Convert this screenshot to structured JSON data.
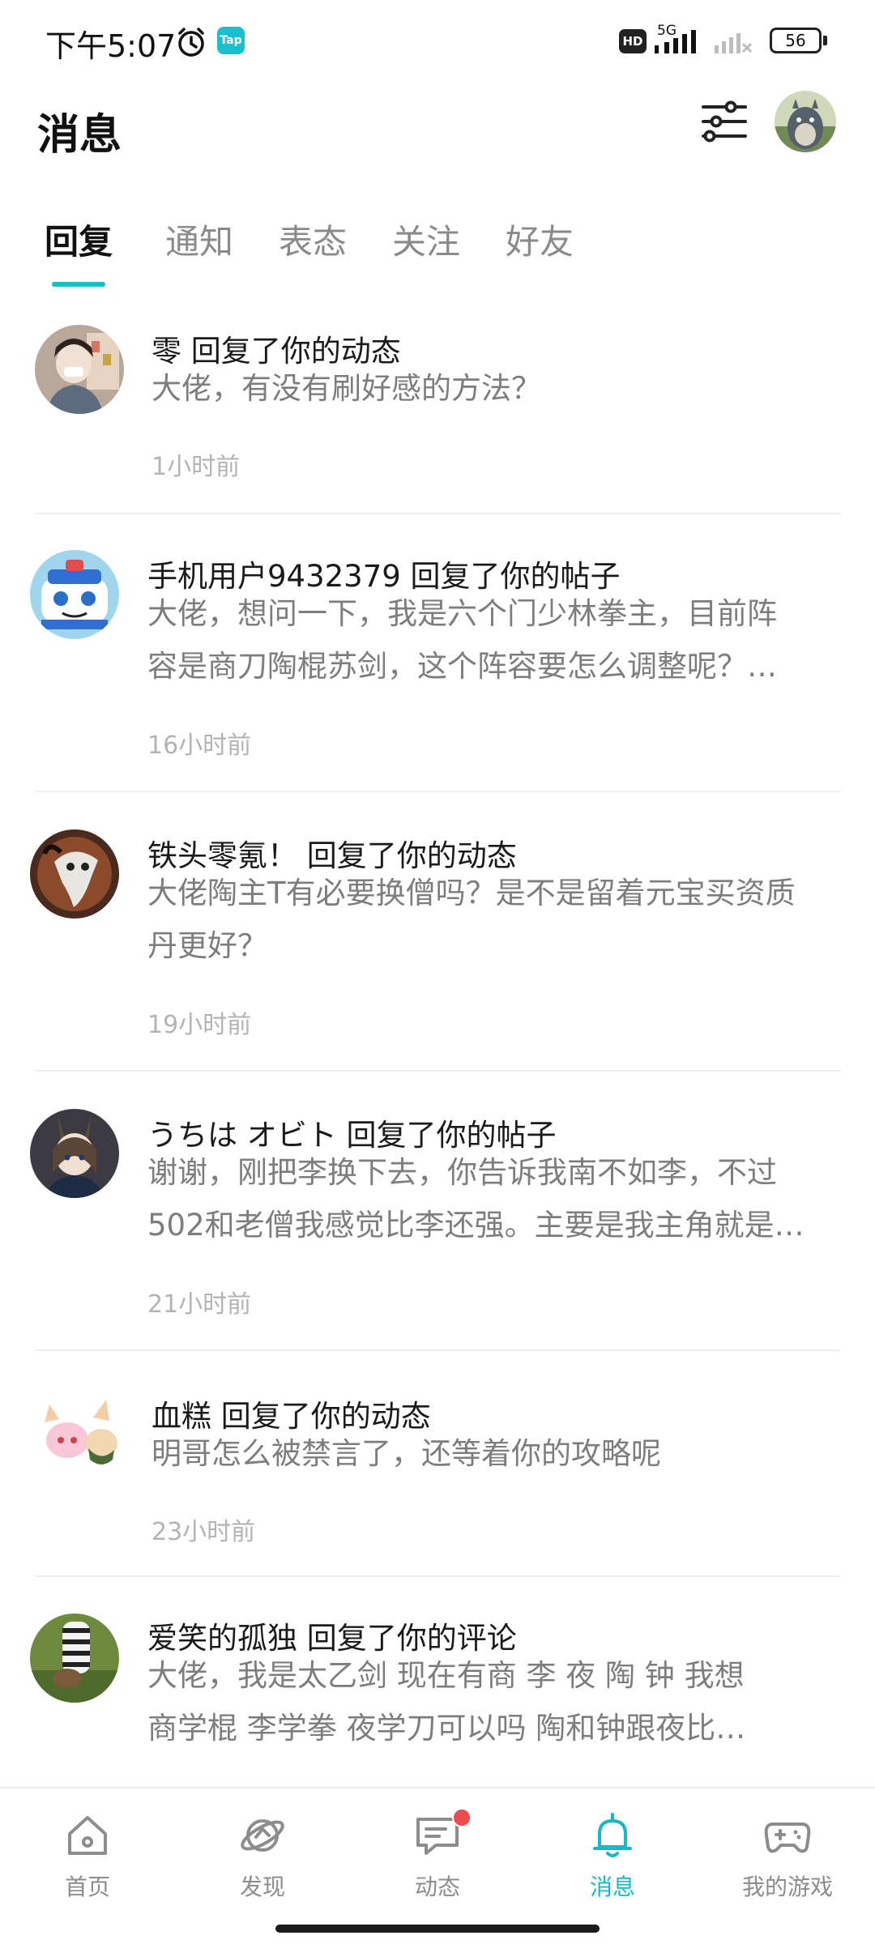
{
  "status_bar": {
    "time": "下午5:07",
    "app_badge": "Tap",
    "hd": "HD",
    "network": "5G",
    "battery": "56"
  },
  "header": {
    "title": "消息"
  },
  "tabs": [
    {
      "label": "回复",
      "active": true
    },
    {
      "label": "通知",
      "active": false
    },
    {
      "label": "表态",
      "active": false
    },
    {
      "label": "关注",
      "active": false
    },
    {
      "label": "好友",
      "active": false
    }
  ],
  "messages": [
    {
      "title": "零 回复了你的动态",
      "body": [
        "大佬，有没有刷好感的方法？"
      ],
      "time": "1小时前"
    },
    {
      "title": "手机用户9432379 回复了你的帖子",
      "body": [
        "大佬，想问一下，我是六个门少林拳主，目前阵",
        "容是商刀陶棍苏剑，这个阵容要怎么调整呢？…"
      ],
      "time": "16小时前"
    },
    {
      "title": "铁头零氪！ 回复了你的动态",
      "body": [
        "大佬陶主T有必要换僧吗？是不是留着元宝买资质",
        "丹更好？"
      ],
      "time": "19小时前"
    },
    {
      "title": "うちは オビト 回复了你的帖子",
      "body": [
        "谢谢，刚把李换下去，你告诉我南不如李，不过",
        "502和老僧我感觉比李还强。主要是我主角就是…"
      ],
      "time": "21小时前"
    },
    {
      "title": "血糕 回复了你的动态",
      "body": [
        "明哥怎么被禁言了，还等着你的攻略呢"
      ],
      "time": "23小时前"
    },
    {
      "title": "爱笑的孤独 回复了你的评论",
      "body": [
        "大佬，我是太乙剑  现在有商  李   夜  陶  钟   我想",
        "商学棍  李学拳  夜学刀可以吗   陶和钟跟夜比…"
      ],
      "time": ""
    }
  ],
  "bottom_nav": [
    {
      "label": "首页",
      "icon": "home-icon",
      "active": false
    },
    {
      "label": "发现",
      "icon": "discover-icon",
      "active": false
    },
    {
      "label": "动态",
      "icon": "feed-icon",
      "active": false,
      "badge": true
    },
    {
      "label": "消息",
      "icon": "bell-icon",
      "active": true
    },
    {
      "label": "我的游戏",
      "icon": "gamepad-icon",
      "active": false
    }
  ],
  "colors": {
    "accent": "#18bfc8",
    "title_text": "#1a1a1a",
    "body_text": "#7d7d7d",
    "time_text": "#b3b3b3",
    "badge_red": "#f04b4b"
  }
}
